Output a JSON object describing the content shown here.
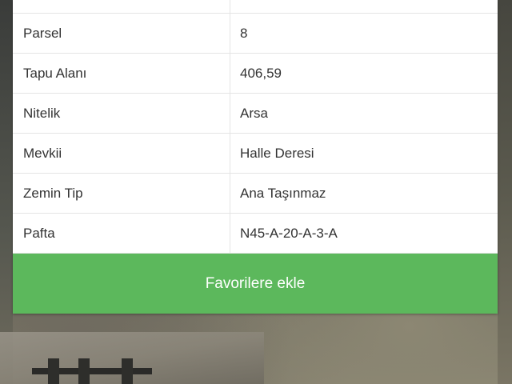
{
  "colors": {
    "button_bg": "#5cb85c",
    "button_text": "#ffffff",
    "row_border": "#e3e3e3",
    "text": "#333333"
  },
  "details": {
    "rows": [
      {
        "label": "",
        "value": ""
      },
      {
        "label": "Parsel",
        "value": "8"
      },
      {
        "label": "Tapu Alanı",
        "value": "406,59"
      },
      {
        "label": "Nitelik",
        "value": "Arsa"
      },
      {
        "label": "Mevkii",
        "value": "Halle Deresi"
      },
      {
        "label": "Zemin Tip",
        "value": "Ana Taşınmaz"
      },
      {
        "label": "Pafta",
        "value": "N45-A-20-A-3-A"
      }
    ]
  },
  "actions": {
    "favorite_label": "Favorilere ekle"
  }
}
